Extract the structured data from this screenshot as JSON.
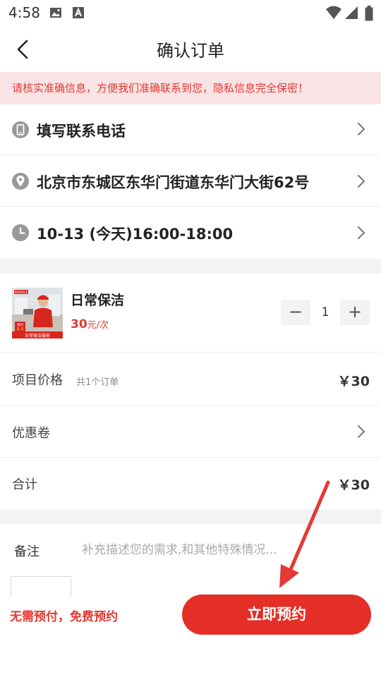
{
  "status_bar": {
    "time": "4:58",
    "left_icons": [
      "gallery-icon",
      "font-a-icon"
    ],
    "right_icons": [
      "wifi-icon",
      "cell-signal-icon",
      "battery-icon"
    ]
  },
  "header": {
    "title": "确认订单",
    "back_icon": "chevron-left-icon"
  },
  "notice": {
    "text": "请核实准确信息，方便我们准确联系到您，隐私信息完全保密！"
  },
  "contact_rows": [
    {
      "icon": "phone-icon",
      "text": "填写联系电话"
    },
    {
      "icon": "location-pin-icon",
      "text": "北京市东城区东华门街道东华门大街62号"
    },
    {
      "icon": "clock-icon",
      "text": "10-13 (今天)16:00-18:00"
    }
  ],
  "service": {
    "name": "日常保洁",
    "price": "30",
    "unit": "元/次",
    "quantity": "1",
    "minus": "−",
    "plus": "+",
    "thumbnail": {
      "badge": "SERVICE",
      "label": "日常保洁服务",
      "price_tag_line1": "限时",
      "price_tag_line2": "4.0"
    }
  },
  "summary": {
    "item_price_label": "项目价格",
    "order_count": "共1个订单",
    "item_price_amount": "￥30",
    "coupon_label": "优惠卷",
    "total_label": "合计",
    "total_amount": "￥30"
  },
  "remark": {
    "label": "备注",
    "placeholder": "补充描述您的需求,和其他特殊情况..."
  },
  "footer": {
    "note": "无需预付，免费预约",
    "submit_label": "立即预约"
  },
  "colors": {
    "accent": "#e42f26",
    "notice_bg": "#f9e3e4",
    "separator_bg": "#f2f3f5",
    "annotation_arrow": "#e53935"
  }
}
